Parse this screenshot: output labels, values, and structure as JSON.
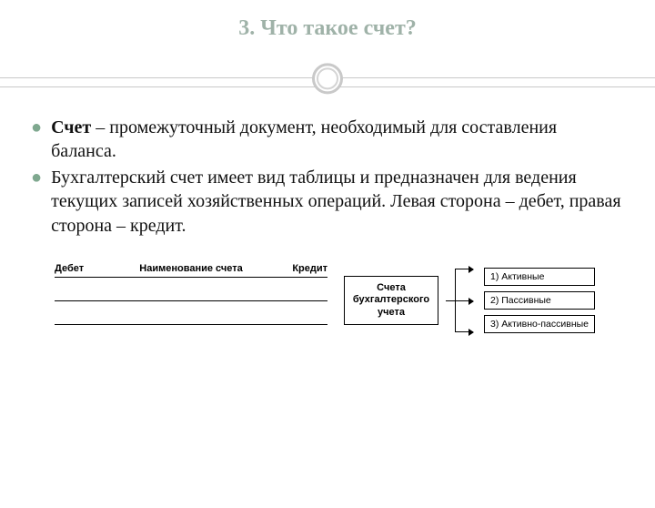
{
  "title": "3. Что такое счет?",
  "bullets": {
    "b1": {
      "term": "Счет",
      "rest": " – промежуточный документ, необходимый для составления баланса."
    },
    "b2": {
      "text": "Бухгалтерский счет имеет вид таблицы и предназначен для ведения текущих записей хозяйственных операций. Левая сторона – дебет, правая сторона – кредит."
    }
  },
  "tform": {
    "left": "Дебет",
    "center": "Наименование счета",
    "right": "Кредит"
  },
  "diagram": {
    "center_line1": "Счета",
    "center_line2": "бухгалтерского",
    "center_line3": "учета",
    "types": {
      "t1": "1) Активные",
      "t2": "2) Пассивные",
      "t3": "3) Активно-пассивные"
    }
  }
}
